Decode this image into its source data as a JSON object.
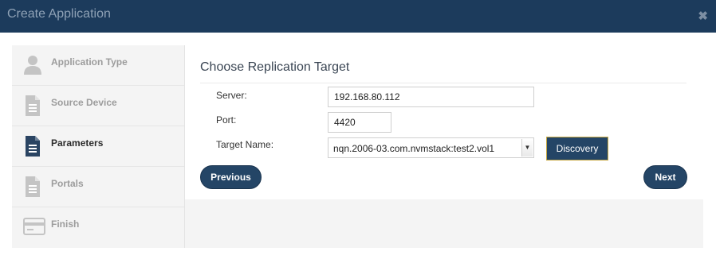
{
  "dialog": {
    "title": "Create Application",
    "close_glyph": "✖"
  },
  "steps": [
    {
      "label": "Application Type",
      "icon": "user-icon",
      "active": false
    },
    {
      "label": "Source Device",
      "icon": "document-icon",
      "active": false
    },
    {
      "label": "Parameters",
      "icon": "document-icon",
      "active": true
    },
    {
      "label": "Portals",
      "icon": "document-icon",
      "active": false
    },
    {
      "label": "Finish",
      "icon": "credit-card-icon",
      "active": false
    }
  ],
  "form": {
    "heading": "Choose Replication Target",
    "server": {
      "label": "Server:",
      "value": "192.168.80.112"
    },
    "port": {
      "label": "Port:",
      "value": "4420"
    },
    "target_name": {
      "label": "Target Name:",
      "value": "nqn.2006-03.com.nvmstack:test2.vol1"
    },
    "discovery_label": "Discovery"
  },
  "nav": {
    "previous_label": "Previous",
    "next_label": "Next"
  },
  "colors": {
    "header_bg": "#1c3b5c",
    "primary_button": "#244566",
    "active_icon": "#2a4462",
    "inactive_icon": "#c4c4c4"
  }
}
